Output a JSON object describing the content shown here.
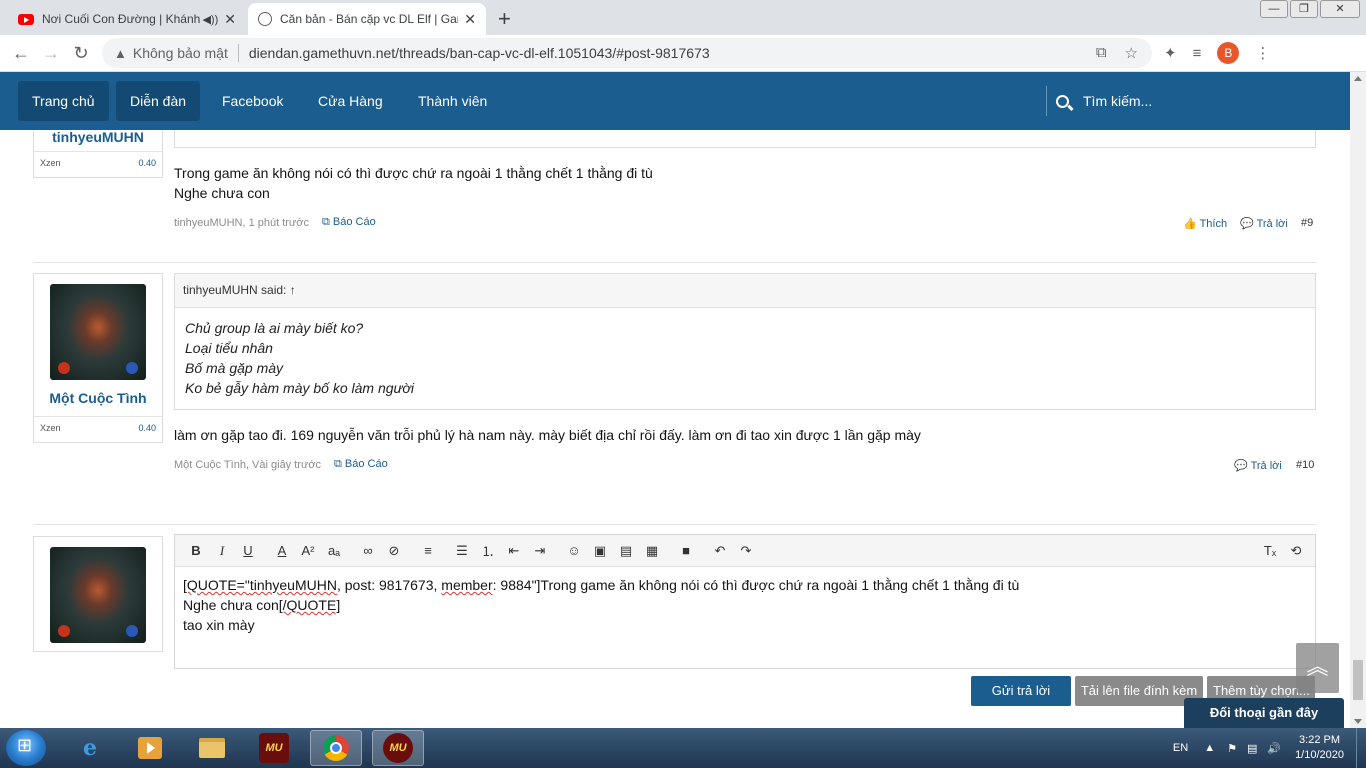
{
  "browser": {
    "tabs": [
      {
        "title": "Nơi Cuối Con Đường | Khánh",
        "active": false,
        "icon": "youtube-icon",
        "muted_icon": "speaker-icon"
      },
      {
        "title": "Căn bản - Bán cặp vc DL Elf | Gam",
        "active": true,
        "icon": "globe-icon"
      }
    ],
    "security_label": "Không bảo mật",
    "url": "diendan.gamethuvn.net/threads/ban-cap-vc-dl-elf.1051043/#post-9817673",
    "profile_initial": "B"
  },
  "nav": {
    "home": "Trang chủ",
    "forums": "Diễn đàn",
    "facebook": "Facebook",
    "store": "Cửa Hàng",
    "members": "Thành viên",
    "search": "Tìm kiếm..."
  },
  "posts": [
    {
      "author": "tinhyeuMUHN",
      "stat_label": "Xzen",
      "stat_value": "0.40",
      "lines": [
        "Trong game ăn không nói có thì được chứ ra ngoài 1 thằng chết 1 thằng đi tù",
        "Nghe chưa con"
      ],
      "meta": "tinhyeuMUHN, 1 phút trước",
      "report": "Báo Cáo",
      "like": "Thích",
      "reply": "Trả lời",
      "number": "#9"
    },
    {
      "author": "Một Cuộc Tình",
      "stat_label": "Xzen",
      "stat_value": "0.40",
      "quote_header": "tinhyeuMUHN said: ↑",
      "quote_lines": [
        "Chủ group là ai mày biết ko?",
        "Loại tiểu nhân",
        "Bố mà gặp mày",
        "Ko bẻ gẫy hàm mày bố ko làm người"
      ],
      "lines": [
        "làm ơn gặp tao đi. 169 nguyễn văn trỗi phủ lý hà nam này. mày biết địa chỉ rồi đấy. làm ơn đi tao xin được 1 lần gặp mày"
      ],
      "meta": "Một Cuộc Tình, Vài giây trước",
      "report": "Báo Cáo",
      "reply": "Trả lời",
      "number": "#10"
    }
  ],
  "editor": {
    "line1_a": "[QUOTE=\"",
    "line1_user": "tinhyeuMUHN",
    "line1_b": ", post: 9817673, ",
    "line1_member": "member",
    "line1_c": ": 9884\"]Trong game ăn không nói có thì được chứ ra ngoài 1 thằng chết 1 thằng đi tù",
    "line2_a": "Nghe chưa con",
    "line2_b": "[/QUOTE]",
    "line3": "tao xin mày"
  },
  "buttons": {
    "submit": "Gửi trả lời",
    "upload": "Tải lên file đính kèm",
    "more": "Thêm tùy chọn...",
    "recent": "Đối thoại gần đây"
  },
  "taskbar": {
    "lang": "EN",
    "time": "3:22 PM",
    "date": "1/10/2020",
    "mu_label": "MU"
  },
  "colors": {
    "site_nav": "#1a5d8e",
    "link": "#1a5d8e",
    "corner_badge": "#6aaa2a"
  }
}
